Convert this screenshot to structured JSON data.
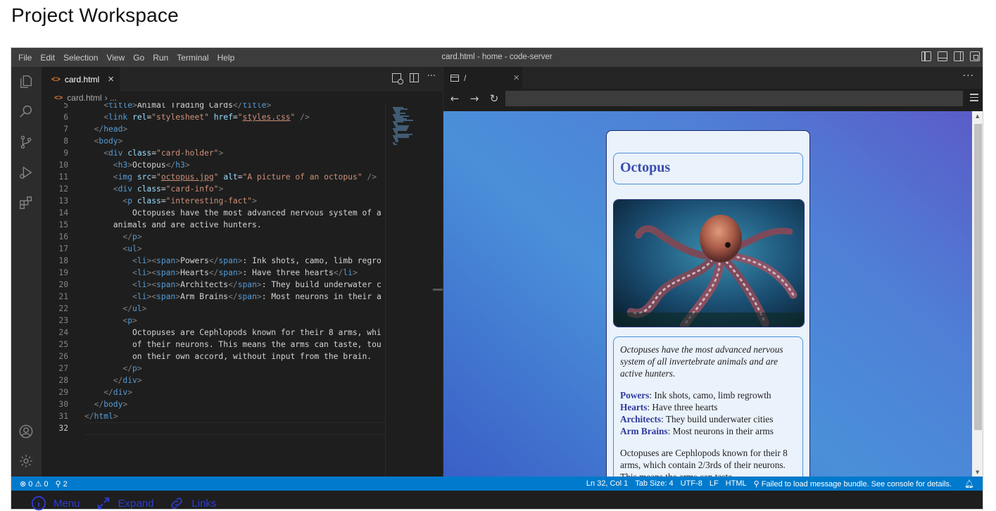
{
  "page": {
    "title": "Project Workspace"
  },
  "menubar": {
    "items": [
      "File",
      "Edit",
      "Selection",
      "View",
      "Go",
      "Run",
      "Terminal",
      "Help"
    ],
    "window_title": "card.html - home - code-server"
  },
  "activity_icons": [
    "files-icon",
    "search-icon",
    "source-control-icon",
    "run-debug-icon",
    "extensions-icon",
    "account-icon",
    "settings-gear-icon"
  ],
  "editor": {
    "tab_label": "card.html",
    "breadcrumb_file": "card.html",
    "breadcrumb_rest": "› ..."
  },
  "code_lines": [
    {
      "n": "5",
      "html": "<span class='t-br'>&lt;</span><span class='t-tag'>title</span><span class='t-br'>&gt;</span>Animal Trading Cards<span class='t-br'>&lt;/</span><span class='t-tag'>title</span><span class='t-br'>&gt;</span>",
      "indent": 4
    },
    {
      "n": "6",
      "html": "<span class='t-br'>&lt;</span><span class='t-tag'>link</span> <span class='t-attr'>rel</span>=<span class='t-str'>\"stylesheet\"</span> <span class='t-attr'>href</span>=<span class='t-str'>\"<span class='t-link'>styles.css</span>\"</span> <span class='t-br'>/&gt;</span>",
      "indent": 4
    },
    {
      "n": "7",
      "html": "<span class='t-br'>&lt;/</span><span class='t-tag'>head</span><span class='t-br'>&gt;</span>",
      "indent": 2
    },
    {
      "n": "8",
      "html": "<span class='t-br'>&lt;</span><span class='t-tag'>body</span><span class='t-br'>&gt;</span>",
      "indent": 2
    },
    {
      "n": "9",
      "html": "<span class='t-br'>&lt;</span><span class='t-tag'>div</span> <span class='t-attr'>class</span>=<span class='t-str'>\"card-holder\"</span><span class='t-br'>&gt;</span>",
      "indent": 4
    },
    {
      "n": "10",
      "html": "<span class='t-br'>&lt;</span><span class='t-tag'>h3</span><span class='t-br'>&gt;</span>Octopus<span class='t-br'>&lt;/</span><span class='t-tag'>h3</span><span class='t-br'>&gt;</span>",
      "indent": 6
    },
    {
      "n": "11",
      "html": "<span class='t-br'>&lt;</span><span class='t-tag'>img</span> <span class='t-attr'>src</span>=<span class='t-str'>\"<span class='t-link'>octopus.jpg</span>\"</span> <span class='t-attr'>alt</span>=<span class='t-str'>\"A picture of an octopus\"</span> <span class='t-br'>/&gt;</span>",
      "indent": 6
    },
    {
      "n": "12",
      "html": "<span class='t-br'>&lt;</span><span class='t-tag'>div</span> <span class='t-attr'>class</span>=<span class='t-str'>\"card-info\"</span><span class='t-br'>&gt;</span>",
      "indent": 6
    },
    {
      "n": "13",
      "html": "<span class='t-br'>&lt;</span><span class='t-tag'>p</span> <span class='t-attr'>class</span>=<span class='t-str'>\"interesting-fact\"</span><span class='t-br'>&gt;</span>",
      "indent": 8
    },
    {
      "n": "14",
      "html": "Octopuses have the most advanced nervous system of a",
      "indent": 10
    },
    {
      "n": "15",
      "html": "animals and are active hunters.",
      "indent": 6
    },
    {
      "n": "16",
      "html": "<span class='t-br'>&lt;/</span><span class='t-tag'>p</span><span class='t-br'>&gt;</span>",
      "indent": 8
    },
    {
      "n": "17",
      "html": "<span class='t-br'>&lt;</span><span class='t-tag'>ul</span><span class='t-br'>&gt;</span>",
      "indent": 8
    },
    {
      "n": "18",
      "html": "<span class='t-br'>&lt;</span><span class='t-tag'>li</span><span class='t-br'>&gt;&lt;</span><span class='t-tag'>span</span><span class='t-br'>&gt;</span>Powers<span class='t-br'>&lt;/</span><span class='t-tag'>span</span><span class='t-br'>&gt;</span>: Ink shots, camo, limb regro",
      "indent": 10
    },
    {
      "n": "19",
      "html": "<span class='t-br'>&lt;</span><span class='t-tag'>li</span><span class='t-br'>&gt;&lt;</span><span class='t-tag'>span</span><span class='t-br'>&gt;</span>Hearts<span class='t-br'>&lt;/</span><span class='t-tag'>span</span><span class='t-br'>&gt;</span>: Have three hearts<span class='t-br'>&lt;/</span><span class='t-tag'>li</span><span class='t-br'>&gt;</span>",
      "indent": 10
    },
    {
      "n": "20",
      "html": "<span class='t-br'>&lt;</span><span class='t-tag'>li</span><span class='t-br'>&gt;&lt;</span><span class='t-tag'>span</span><span class='t-br'>&gt;</span>Architects<span class='t-br'>&lt;/</span><span class='t-tag'>span</span><span class='t-br'>&gt;</span>: They build underwater c",
      "indent": 10
    },
    {
      "n": "21",
      "html": "<span class='t-br'>&lt;</span><span class='t-tag'>li</span><span class='t-br'>&gt;&lt;</span><span class='t-tag'>span</span><span class='t-br'>&gt;</span>Arm Brains<span class='t-br'>&lt;/</span><span class='t-tag'>span</span><span class='t-br'>&gt;</span>: Most neurons in their a",
      "indent": 10
    },
    {
      "n": "22",
      "html": "<span class='t-br'>&lt;/</span><span class='t-tag'>ul</span><span class='t-br'>&gt;</span>",
      "indent": 8
    },
    {
      "n": "23",
      "html": "<span class='t-br'>&lt;</span><span class='t-tag'>p</span><span class='t-br'>&gt;</span>",
      "indent": 8
    },
    {
      "n": "24",
      "html": "Octopuses are Cephlopods known for their 8 arms, whi",
      "indent": 10
    },
    {
      "n": "25",
      "html": "of their neurons. This means the arms can taste, tou",
      "indent": 10
    },
    {
      "n": "26",
      "html": "on their own accord, without input from the brain.",
      "indent": 10
    },
    {
      "n": "27",
      "html": "<span class='t-br'>&lt;/</span><span class='t-tag'>p</span><span class='t-br'>&gt;</span>",
      "indent": 8
    },
    {
      "n": "28",
      "html": "<span class='t-br'>&lt;/</span><span class='t-tag'>div</span><span class='t-br'>&gt;</span>",
      "indent": 6
    },
    {
      "n": "29",
      "html": "<span class='t-br'>&lt;/</span><span class='t-tag'>div</span><span class='t-br'>&gt;</span>",
      "indent": 4
    },
    {
      "n": "30",
      "html": "<span class='t-br'>&lt;/</span><span class='t-tag'>body</span><span class='t-br'>&gt;</span>",
      "indent": 2
    },
    {
      "n": "31",
      "html": "<span class='t-br'>&lt;/</span><span class='t-tag'>html</span><span class='t-br'>&gt;</span>",
      "indent": 0
    },
    {
      "n": "32",
      "html": "",
      "indent": 0
    }
  ],
  "browser": {
    "tab_label": "/",
    "url": "",
    "card": {
      "title": "Octopus",
      "image_alt": "A picture of an octopus",
      "fact": "Octopuses have the most advanced nervous system of all invertebrate animals and are active hunters.",
      "facts": [
        {
          "k": "Powers",
          "v": ": Ink shots, camo, limb regrowth"
        },
        {
          "k": "Hearts",
          "v": ": Have three hearts"
        },
        {
          "k": "Architects",
          "v": ": They build underwater cities"
        },
        {
          "k": "Arm Brains",
          "v": ": Most neurons in their arms"
        }
      ],
      "desc": "Octopuses are Cephlopods known for their 8 arms, which contain 2/3rds of their neurons. This means the arms can taste,"
    }
  },
  "statusbar": {
    "errors": "0",
    "warnings": "0",
    "ports": "2",
    "position": "Ln 32, Col 1",
    "tab_size": "Tab Size: 4",
    "encoding": "UTF-8",
    "eol": "LF",
    "language": "HTML",
    "message": "Failed to load message bundle. See console for details."
  },
  "bottom_links": {
    "menu": "Menu",
    "expand": "Expand",
    "links": "Links"
  },
  "colors": {
    "accent": "#007acc",
    "link": "#2f3bd0"
  }
}
